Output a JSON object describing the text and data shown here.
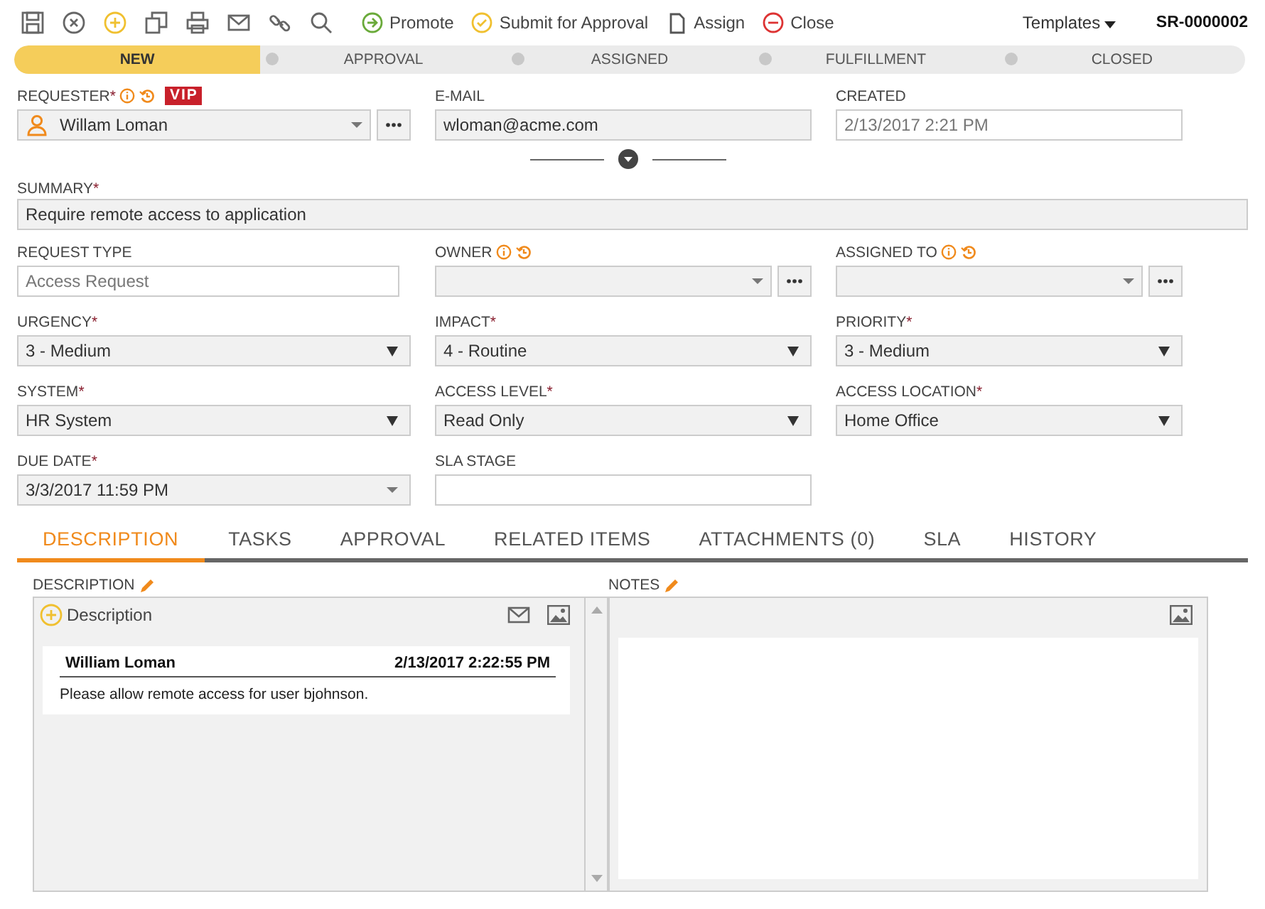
{
  "toolbar": {
    "actions": [
      {
        "kind": "promote",
        "label": "Promote"
      },
      {
        "kind": "submit",
        "label": "Submit for Approval"
      },
      {
        "kind": "assign",
        "label": "Assign"
      },
      {
        "kind": "close",
        "label": "Close"
      }
    ],
    "templates": "Templates",
    "record_id": "SR-0000002"
  },
  "stages": [
    {
      "label": "NEW",
      "selected": true
    },
    {
      "label": "APPROVAL",
      "selected": false
    },
    {
      "label": "ASSIGNED",
      "selected": false
    },
    {
      "label": "FULFILLMENT",
      "selected": false
    },
    {
      "label": "CLOSED",
      "selected": false
    }
  ],
  "header_fields": [
    {
      "kind": "user-lookup",
      "label": "REQUESTER",
      "required_mark": "*",
      "info": true,
      "badge": "VIP",
      "value": "Willam Loman"
    },
    {
      "kind": "input",
      "label": "E-MAIL",
      "info": false,
      "value": "wloman@acme.com"
    },
    {
      "kind": "text",
      "label": "CREATED",
      "info": false,
      "value": "2/13/2017 2:21 PM"
    }
  ],
  "summary": {
    "label": "SUMMARY",
    "required_mark": "*",
    "value": "Require remote access to application"
  },
  "fields": [
    {
      "kind": "text",
      "label": "REQUEST TYPE",
      "info": false,
      "value": "Access Request"
    },
    {
      "kind": "lookup",
      "label": "OWNER",
      "info": true
    },
    {
      "kind": "lookup",
      "label": "ASSIGNED TO",
      "info": true
    },
    {
      "kind": "select",
      "label": "URGENCY",
      "required_mark": "*",
      "info": false,
      "value": "3 - Medium"
    },
    {
      "kind": "select",
      "label": "IMPACT",
      "required_mark": "*",
      "info": false,
      "value": "4 - Routine"
    },
    {
      "kind": "select",
      "label": "PRIORITY",
      "required_mark": "*",
      "info": false,
      "value": "3 - Medium"
    },
    {
      "kind": "select",
      "label": "SYSTEM",
      "required_mark": "*",
      "info": false,
      "value": "HR System"
    },
    {
      "kind": "select",
      "label": "ACCESS LEVEL",
      "required_mark": "*",
      "info": false,
      "value": "Read Only"
    },
    {
      "kind": "select",
      "label": "ACCESS LOCATION",
      "required_mark": "*",
      "info": false,
      "value": "Home Office"
    },
    {
      "kind": "date",
      "label": "DUE DATE",
      "required_mark": "*",
      "info": false,
      "value": "3/3/2017 11:59 PM"
    },
    {
      "kind": "text",
      "label": "SLA STAGE",
      "info": false
    }
  ],
  "tabs": [
    {
      "label": "DESCRIPTION",
      "selected": true
    },
    {
      "label": "TASKS",
      "selected": false
    },
    {
      "label": "APPROVAL",
      "selected": false
    },
    {
      "label": "RELATED ITEMS",
      "selected": false
    },
    {
      "label": "ATTACHMENTS (0)",
      "selected": false
    },
    {
      "label": "SLA",
      "selected": false
    },
    {
      "label": "HISTORY",
      "selected": false
    }
  ],
  "description": {
    "label": "DESCRIPTION",
    "add_label": "Description",
    "entries": [
      {
        "author": "William Loman",
        "time": "2/13/2017 2:22:55 PM",
        "text": "Please allow remote access for user bjohnson."
      }
    ]
  },
  "notes": {
    "label": "NOTES"
  }
}
